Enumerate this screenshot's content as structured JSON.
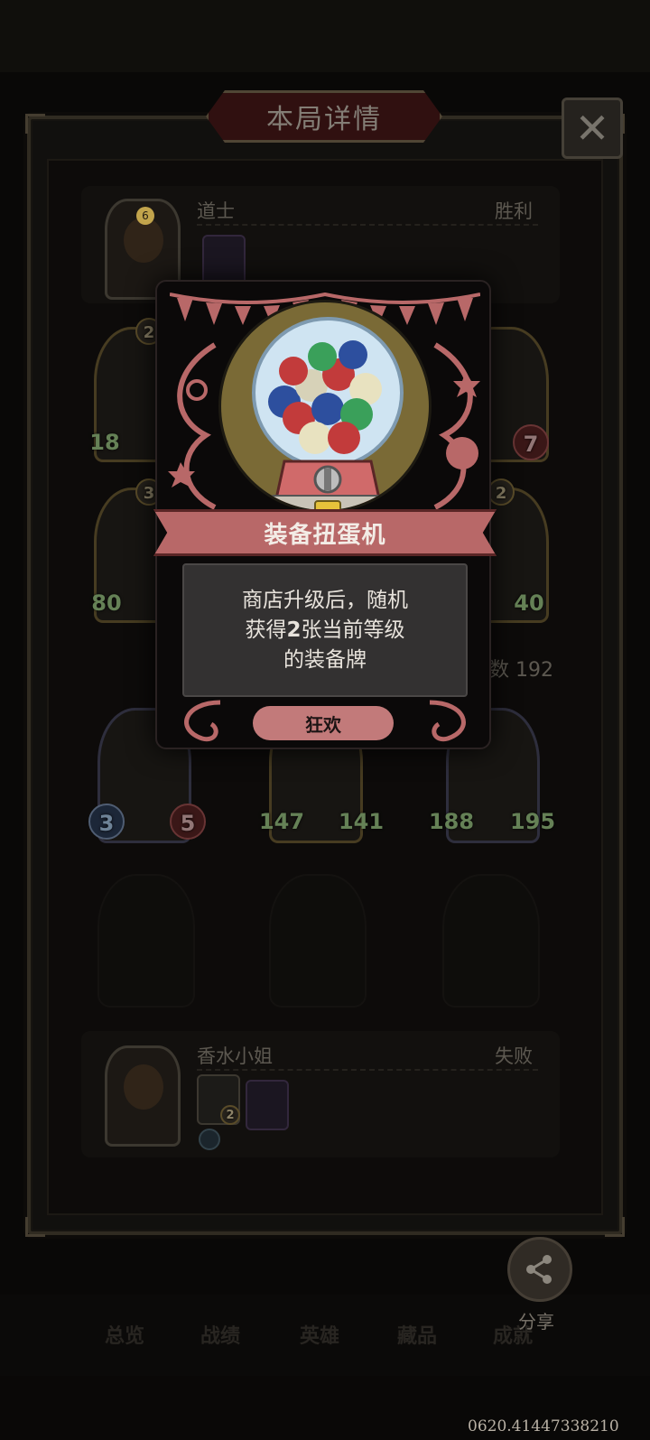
{
  "header": {
    "title": "本局详情",
    "close_label": "✕"
  },
  "top_player": {
    "name": "道士",
    "result": "胜利",
    "level_badge": "6"
  },
  "bottom_player": {
    "name": "香水小姐",
    "result": "失败",
    "item_badge": "2"
  },
  "board": {
    "left_cards": [
      {
        "badge": "2",
        "stat": "18"
      },
      {
        "badge": "3",
        "stat": "80"
      }
    ],
    "right_cards": [
      {
        "stat": "7"
      },
      {
        "badge": "2",
        "stat": "40"
      }
    ],
    "count_label": "数 192",
    "units": [
      {
        "atk": "3",
        "hp": "5"
      },
      {
        "atk": "147",
        "hp": "141"
      },
      {
        "atk": "188",
        "hp": "195"
      }
    ]
  },
  "popup": {
    "title": "装备扭蛋机",
    "description_line1": "商店升级后，随机",
    "description_line2_pre": "获得",
    "description_line2_num": "2",
    "description_line2_post": "张当前等级",
    "description_line3": "的装备牌",
    "tag": "狂欢"
  },
  "bottom_nav": {
    "items": [
      "总览",
      "战绩",
      "英雄",
      "藏品",
      "成就"
    ],
    "share_label": "分享"
  },
  "watermark": "0620.41447338210",
  "colors": {
    "popup_banner": "#b86868",
    "tag_pill": "#c27a7a",
    "atk_green": "#9bc685"
  },
  "icons": [
    "close-icon",
    "share-icon",
    "gumball-machine-icon"
  ]
}
